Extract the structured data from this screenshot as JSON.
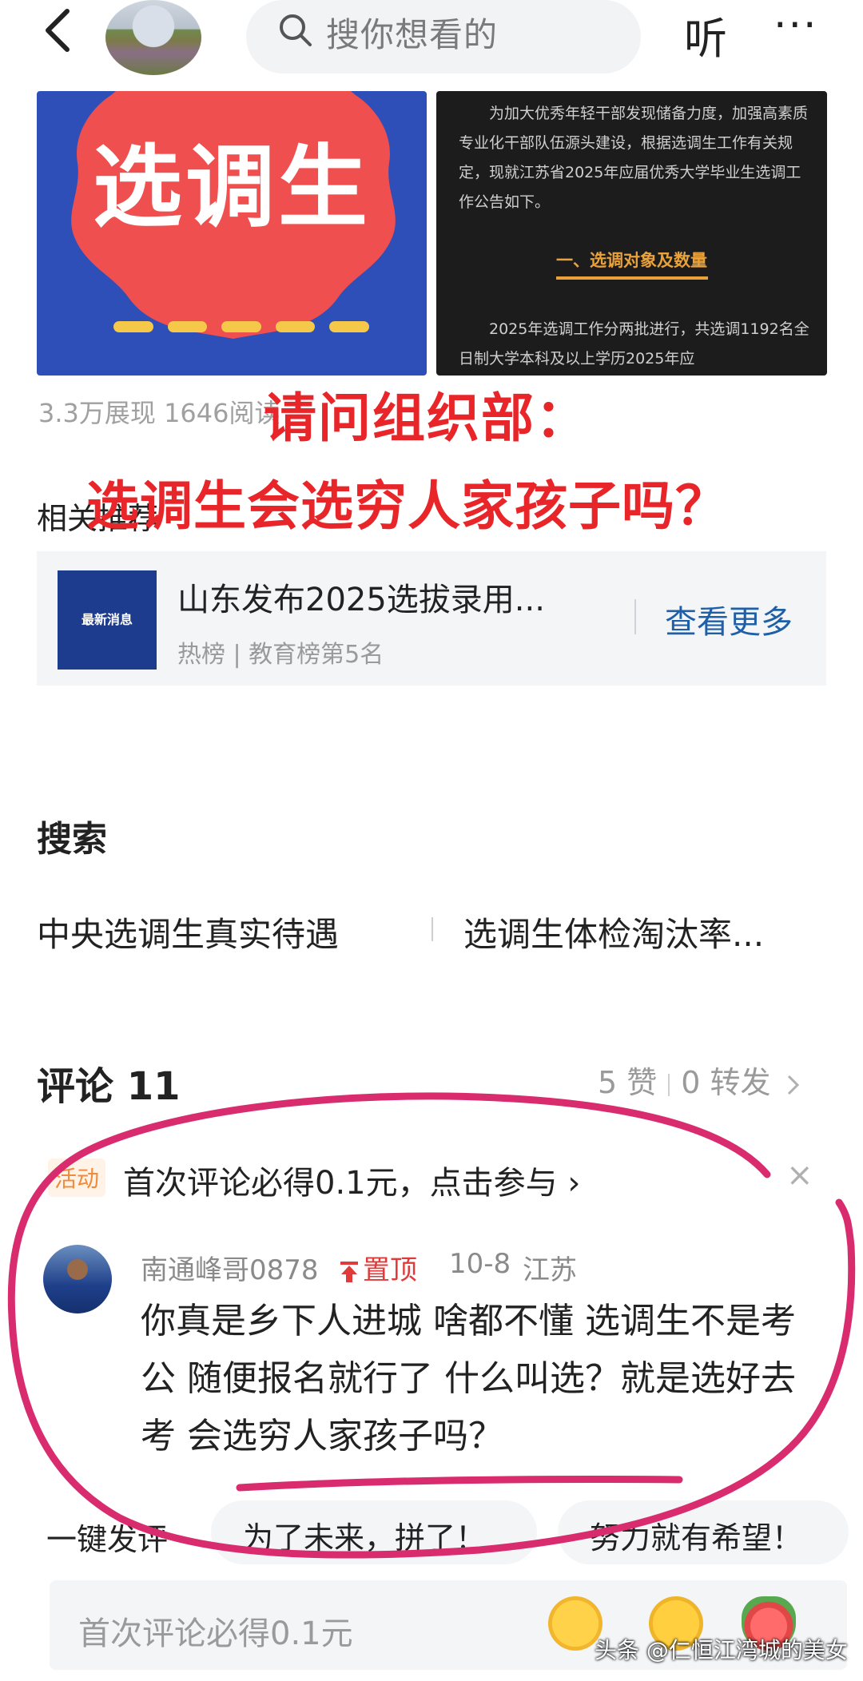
{
  "header": {
    "search_placeholder": "搜你想看的",
    "listen_label": "听",
    "more_label": "···"
  },
  "article_images": {
    "left": {
      "title": "选调生"
    },
    "right": {
      "para1": "为加大优秀年轻干部发现储备力度，加强高素质专业化干部队伍源头建设，根据选调生工作有关规定，现就江苏省2025年应届优秀大学毕业生选调工作公告如下。",
      "heading": "一、选调对象及数量",
      "para2": "2025年选调工作分两批进行，共选调1192名全日制大学本科及以上学历2025年应"
    }
  },
  "stats": "3.3万展现  1646阅读",
  "overlay_text": {
    "line1": "请问组织部：",
    "line2": "选调生会选穷人家孩子吗？"
  },
  "related": {
    "section_title": "相关推荐",
    "thumb_text": "最新消息",
    "title": "山东发布2025选拔录用...",
    "meta": "热榜 | 教育榜第5名",
    "more_label": "查看更多"
  },
  "search": {
    "title": "搜索",
    "suggestions": [
      "中央选调生真实待遇",
      "选调生体检淘汰率..."
    ]
  },
  "comments": {
    "title": "评论 11",
    "likes": "5 赞",
    "reposts": "0 转发",
    "promo_tag": "活动",
    "promo_text": "首次评论必得0.1元，点击参与",
    "promo_arrow": "›",
    "promo_close": "×",
    "item": {
      "user": "南通峰哥0878",
      "pinned": "置顶",
      "date": "10-8",
      "location": "江苏",
      "body": "你真是乡下人进城 啥都不懂 选调生不是考公 随便报名就行了 什么叫选？就是选好去考 会选穷人家孩子吗？"
    }
  },
  "quick_reply": {
    "label": "一键发评",
    "chips": [
      "为了未来，拼了！",
      "努力就有希望！"
    ]
  },
  "input": {
    "placeholder": "首次评论必得0.1元"
  },
  "watermark": "头条 @仁恒江湾城的美女",
  "colors": {
    "accent_red": "#e8262a",
    "link_blue": "#1e5fa8",
    "annotation_pink": "#d92c6e"
  }
}
